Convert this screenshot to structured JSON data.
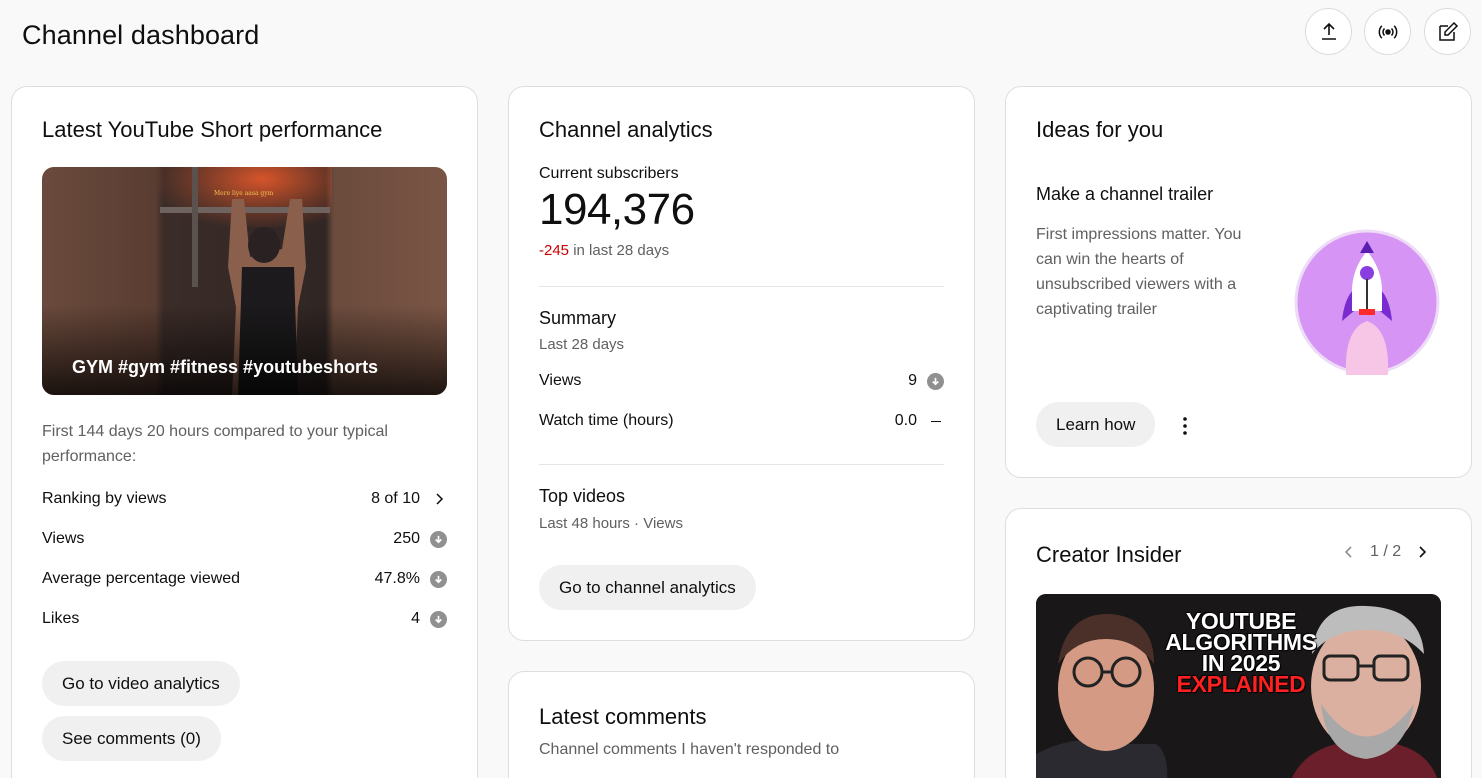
{
  "header": {
    "title": "Channel dashboard",
    "actions": [
      {
        "name": "upload-icon",
        "label": "Upload videos"
      },
      {
        "name": "live-icon",
        "label": "Go live"
      },
      {
        "name": "create-post-icon",
        "label": "Create post"
      }
    ]
  },
  "short_card": {
    "title": "Latest YouTube Short performance",
    "thumbnail_caption": "GYM #gym #fitness #youtubeshorts",
    "thumbnail_overlay_text": "Mere liye aasa gym",
    "description": "First 144 days 20 hours compared to your typical performance:",
    "metrics": [
      {
        "label": "Ranking by views",
        "value": "8 of 10",
        "icon": "chevron-right-icon"
      },
      {
        "label": "Views",
        "value": "250",
        "icon": "arrow-down-icon"
      },
      {
        "label": "Average percentage viewed",
        "value": "47.8%",
        "icon": "arrow-down-icon"
      },
      {
        "label": "Likes",
        "value": "4",
        "icon": "arrow-down-icon"
      }
    ],
    "buttons": {
      "video_analytics": "Go to video analytics",
      "see_comments": "See comments (0)"
    }
  },
  "analytics_card": {
    "title": "Channel analytics",
    "subscribers_label": "Current subscribers",
    "subscribers": "194,376",
    "delta_value": "-245",
    "delta_suffix": "in last 28 days",
    "summary": {
      "title": "Summary",
      "period": "Last 28 days",
      "rows": [
        {
          "label": "Views",
          "value": "9",
          "icon": "arrow-down-icon"
        },
        {
          "label": "Watch time (hours)",
          "value": "0.0",
          "icon": "dash-icon"
        }
      ]
    },
    "top_videos": {
      "title": "Top videos",
      "period": "Last 48 hours · Views"
    },
    "button": "Go to channel analytics"
  },
  "comments_card": {
    "title": "Latest comments",
    "subtitle": "Channel comments I haven't responded to"
  },
  "ideas_card": {
    "title": "Ideas for you",
    "idea_title": "Make a channel trailer",
    "idea_desc": "First impressions matter. You can win the hearts of unsubscribed viewers with a captivating trailer",
    "button": "Learn how"
  },
  "insider_card": {
    "title": "Creator Insider",
    "pager": "1 / 2",
    "thumb_line1": "YOUTUBE",
    "thumb_line2": "ALGORITHMS",
    "thumb_line3": "IN 2025",
    "thumb_line4": "EXPLAINED"
  },
  "colors": {
    "background": "#f9f9f9",
    "card": "#ffffff",
    "negative": "#cc0000",
    "muted_text": "#606060",
    "pill": "#f0f0f0",
    "rocket_circle": "#d694f5"
  }
}
